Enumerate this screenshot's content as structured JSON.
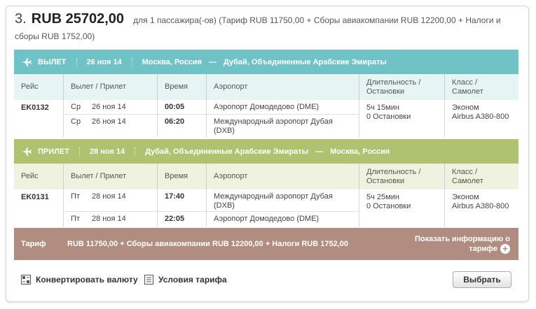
{
  "header": {
    "number": "3.",
    "price": "RUB 25702,00",
    "desc_line1": "для 1 пассажира(-ов) (Тариф RUB 11750,00 + Сборы авиакомпании RUB 12200,00 + Налоги и",
    "desc_line2": "сборы RUB 1752,00)"
  },
  "outbound": {
    "label": "ВЫЛЕТ",
    "date": "26 ноя 14",
    "from": "Москва, Россия",
    "dash": "—",
    "to": "Дубай, Объединенные Арабские Эмираты",
    "headers": {
      "flight": "Рейс",
      "depart_arrive": "Вылет / Прилет",
      "time": "Время",
      "airport": "Аэропорт",
      "duration_1": "Длительность /",
      "duration_2": "Остановки",
      "class_1": "Класс /",
      "class_2": "Самолет"
    },
    "flight_no": "EK0132",
    "legs": [
      {
        "dow": "Ср",
        "date": "26 ноя 14",
        "time": "00:05",
        "airport": "Аэропорт Домодедово (DME)"
      },
      {
        "dow": "Ср",
        "date": "26 ноя 14",
        "time": "06:20",
        "airport": "Международный аэропорт Дубая (DXB)"
      }
    ],
    "duration": "5ч 15мин",
    "stops": "0 Остановки",
    "class": "Эконом",
    "aircraft": "Airbus A380-800"
  },
  "return": {
    "label": "ПРИЛЕТ",
    "date": "28 ноя 14",
    "from": "Дубай, Объединенные Арабские Эмираты",
    "dash": "—",
    "to": "Москва, Россия",
    "headers": {
      "flight": "Рейс",
      "depart_arrive": "Вылет / Прилет",
      "time": "Время",
      "airport": "Аэропорт",
      "duration_1": "Длительность /",
      "duration_2": "Остановки",
      "class_1": "Класс /",
      "class_2": "Самолет"
    },
    "flight_no": "EK0131",
    "legs": [
      {
        "dow": "Пт",
        "date": "28 ноя 14",
        "time": "17:40",
        "airport": "Международный аэропорт Дубая (DXB)"
      },
      {
        "dow": "Пт",
        "date": "28 ноя 14",
        "time": "22:05",
        "airport": "Аэропорт Домодедово (DME)"
      }
    ],
    "duration": "5ч 25мин",
    "stops": "0 Остановки",
    "class": "Эконом",
    "aircraft": "Airbus A380-800"
  },
  "fare": {
    "label": "Тариф",
    "text": "RUB 11750,00 + Сборы авиакомпании RUB 12200,00 + Налоги RUB 1752,00",
    "link_line1": "Показать информацию о",
    "link_line2": "тарифе",
    "plus": "+"
  },
  "footer": {
    "convert": "Конвертировать валюту",
    "rules": "Условия тарифа",
    "select": "Выбрать"
  },
  "colors": {
    "outbound_band": "#6fc3c6",
    "return_band": "#aec26f",
    "fare_band": "#b08d80"
  }
}
